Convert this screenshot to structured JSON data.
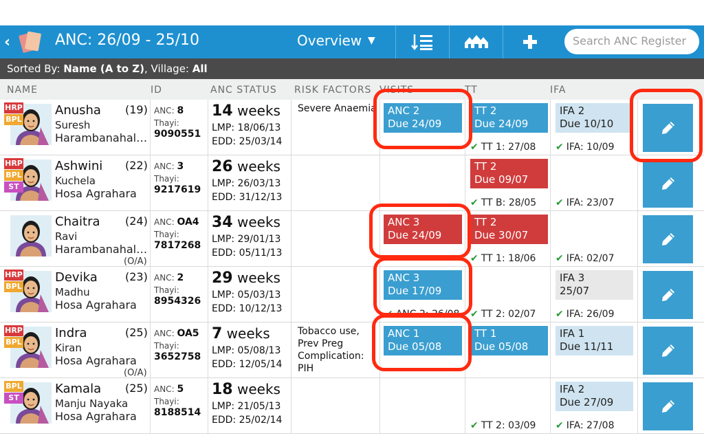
{
  "header": {
    "back_glyph": "‹",
    "title": "ANC: 26/09 - 25/10",
    "view": "Overview",
    "search_placeholder": "Search ANC Register",
    "icons": [
      "sort-icon",
      "village-filter-icon",
      "add-icon"
    ]
  },
  "sortbar": {
    "sorted_by_label": "Sorted By:",
    "sorted_by": "Name (A to Z)",
    "village_label": ", Village:",
    "village": "All"
  },
  "columns": [
    "NAME",
    "ID",
    "ANC STATUS",
    "RISK FACTORS",
    "VISITS",
    "TT",
    "IFA"
  ],
  "rows": [
    {
      "badges": [
        "HRP",
        "BPL"
      ],
      "name": "Anusha",
      "age": "(19)",
      "husband": "Suresh",
      "village": "Harambanahalli ...",
      "oa": "",
      "anc_label": "ANC:",
      "anc": "8",
      "thayi_label": "Thayi:",
      "thayi": "9090551",
      "weeks_num": "14",
      "weeks_unit": " weeks",
      "lmp": "LMP: 18/06/13",
      "edd": "EDD: 25/03/14",
      "risk": "Severe Anaemia",
      "visit": {
        "l1": "ANC 2",
        "l2": "Due 24/09",
        "style": "blue"
      },
      "visit_done": "",
      "tt": {
        "l1": "TT 2",
        "l2": "Due 24/09",
        "style": "blue"
      },
      "tt_done": "TT 1: 27/08",
      "ifa": {
        "l1": "IFA 2",
        "l2": "Due 10/10",
        "style": "lblue"
      },
      "ifa_done": "IFA: 10/09"
    },
    {
      "badges": [
        "HRP",
        "BPL",
        "ST"
      ],
      "name": "Ashwini",
      "age": "(22)",
      "husband": "Kuchela",
      "village": "Hosa Agrahara",
      "oa": "",
      "anc_label": "ANC:",
      "anc": "3",
      "thayi_label": "Thayi:",
      "thayi": "9217619",
      "weeks_num": "26",
      "weeks_unit": " weeks",
      "lmp": "LMP: 26/03/13",
      "edd": "EDD: 31/12/13",
      "risk": "",
      "visit": null,
      "visit_done": "",
      "tt": {
        "l1": "TT 2",
        "l2": "Due 09/07",
        "style": "red"
      },
      "tt_done": "TT B: 28/05",
      "ifa": null,
      "ifa_done": "IFA: 23/07"
    },
    {
      "badges": [],
      "name": "Chaitra",
      "age": "(24)",
      "husband": "Ravi",
      "village": "Harambanahalli ...",
      "oa": "(O/A)",
      "anc_label": "ANC:",
      "anc": "OA4",
      "thayi_label": "Thayi:",
      "thayi": "7817268",
      "weeks_num": "34",
      "weeks_unit": " weeks",
      "lmp": "LMP: 29/01/13",
      "edd": "EDD: 05/11/13",
      "risk": "",
      "visit": {
        "l1": "ANC 3",
        "l2": "Due 24/09",
        "style": "red"
      },
      "visit_done": "",
      "tt": {
        "l1": "TT 2",
        "l2": "Due 30/07",
        "style": "red"
      },
      "tt_done": "TT 1: 18/06",
      "ifa": null,
      "ifa_done": "IFA: 02/07"
    },
    {
      "badges": [
        "HRP",
        "BPL"
      ],
      "name": "Devika",
      "age": "(23)",
      "husband": "Madhu",
      "village": "Hosa Agrahara",
      "oa": "",
      "anc_label": "ANC:",
      "anc": "2",
      "thayi_label": "Thayi:",
      "thayi": "8954326",
      "weeks_num": "29",
      "weeks_unit": " weeks",
      "lmp": "LMP: 05/03/13",
      "edd": "EDD: 10/12/13",
      "risk": "",
      "visit": {
        "l1": "ANC 3",
        "l2": "Due 17/09",
        "style": "blue"
      },
      "visit_done": "ANC 2: 26/08",
      "tt": null,
      "tt_done": "TT 2: 02/07",
      "ifa": {
        "l1": "IFA 3",
        "l2": "25/07",
        "style": "grey"
      },
      "ifa_done": "IFA: 26/09"
    },
    {
      "badges": [
        "HRP",
        "BPL"
      ],
      "name": "Indra",
      "age": "(25)",
      "husband": "Kiran",
      "village": "Hosa Agrahara",
      "oa": "(O/A)",
      "anc_label": "ANC:",
      "anc": "OA5",
      "thayi_label": "Thayi:",
      "thayi": "3652758",
      "weeks_num": "7",
      "weeks_unit": " weeks",
      "lmp": "LMP: 05/08/13",
      "edd": "EDD: 12/05/14",
      "risk": "Tobacco use, Prev Preg Complication: PIH",
      "visit": {
        "l1": "ANC 1",
        "l2": "Due 05/08",
        "style": "blue"
      },
      "visit_done": "",
      "tt": {
        "l1": "TT 1",
        "l2": "Due 05/08",
        "style": "blue"
      },
      "tt_done": "",
      "ifa": {
        "l1": "IFA 1",
        "l2": "Due 11/11",
        "style": "lblue"
      },
      "ifa_done": ""
    },
    {
      "badges": [
        "BPL",
        "ST"
      ],
      "name": "Kamala",
      "age": "(25)",
      "husband": "Manju Nayaka",
      "village": "Hosa Agrahara",
      "oa": "",
      "anc_label": "ANC:",
      "anc": "5",
      "thayi_label": "Thayi:",
      "thayi": "8188514",
      "weeks_num": "18",
      "weeks_unit": " weeks",
      "lmp": "LMP: 21/05/13",
      "edd": "EDD: 25/02/14",
      "risk": "",
      "visit": null,
      "visit_done": "",
      "tt": null,
      "tt_done": "TT 2: 03/09",
      "ifa": {
        "l1": "IFA 2",
        "l2": "Due 27/09",
        "style": "lblue"
      },
      "ifa_done": "IFA: 27/08"
    }
  ],
  "colors": {
    "header": "#1e90d0",
    "sortbar": "#4a4a4a",
    "tile_blue": "#3a9ed0",
    "tile_red": "#d03c3c",
    "tile_lightblue": "#cfe4f0",
    "highlight": "#ff2a10"
  }
}
